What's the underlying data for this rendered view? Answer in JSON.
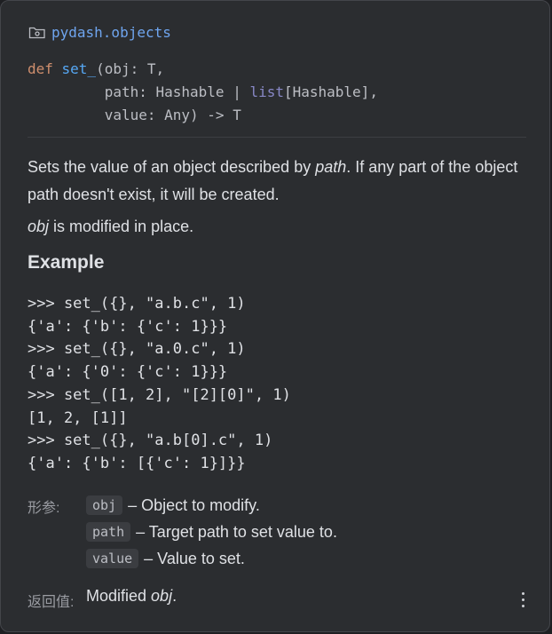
{
  "module": {
    "icon": "folder-icon",
    "name": "pydash.objects"
  },
  "signature": {
    "lines": [
      {
        "tokens": [
          {
            "t": "def ",
            "c": "kw"
          },
          {
            "t": "set_",
            "c": "fn"
          },
          {
            "t": "(obj: T,",
            "c": ""
          }
        ]
      },
      {
        "tokens": [
          {
            "t": "         path: Hashable | ",
            "c": ""
          },
          {
            "t": "list",
            "c": "bt"
          },
          {
            "t": "[Hashable],",
            "c": ""
          }
        ]
      },
      {
        "tokens": [
          {
            "t": "         value: Any) -> T",
            "c": ""
          }
        ]
      }
    ]
  },
  "description": {
    "line1_pre": "Sets the value of an object described by ",
    "line1_em": "path",
    "line1_post": ". If any part of the object path doesn't exist, it will be created.",
    "line2_em": "obj",
    "line2_post": " is modified in place."
  },
  "example": {
    "title": "Example",
    "code": [
      ">>> set_({}, \"a.b.c\", 1)",
      "{'a': {'b': {'c': 1}}}",
      ">>> set_({}, \"a.0.c\", 1)",
      "{'a': {'0': {'c': 1}}}",
      ">>> set_([1, 2], \"[2][0]\", 1)",
      "[1, 2, [1]]",
      ">>> set_({}, \"a.b[0].c\", 1)",
      "{'a': {'b': [{'c': 1}]}}"
    ]
  },
  "params": {
    "label": "形参:",
    "items": [
      {
        "name": "obj",
        "desc": "– Object to modify."
      },
      {
        "name": "path",
        "desc": "– Target path to set value to."
      },
      {
        "name": "value",
        "desc": "– Value to set."
      }
    ]
  },
  "returns": {
    "label": "返回值:",
    "pre": "Modified ",
    "em": "obj",
    "post": "."
  },
  "menu": {
    "icon": "more-vertical-icon"
  },
  "colors": {
    "background": "#2b2d30",
    "keyword": "#cf8e6d",
    "function": "#56a8f5",
    "builtin": "#8888c6",
    "module": "#6fa5ef"
  }
}
